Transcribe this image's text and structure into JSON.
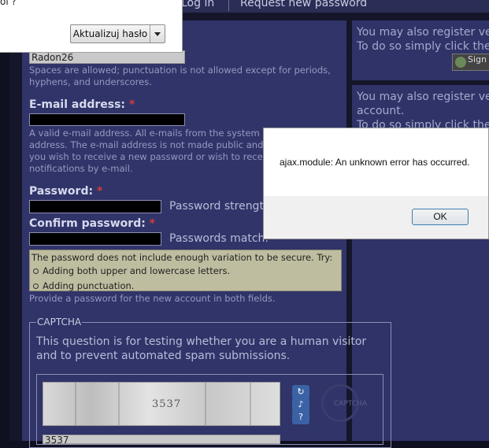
{
  "nav": {
    "tab_login": "Log in",
    "tab_request_password": "Request new password"
  },
  "sidebar": {
    "box1_line1": "You may also register very",
    "box1_line2": "To do so simply click there:",
    "sign_button": "Sign",
    "box2_line1": "You may also register very",
    "box2_line2": "account.",
    "box2_line3": "To do so simply click there:"
  },
  "form": {
    "username_value": "Radon26",
    "username_desc_1": "Spaces are allowed; punctuation is not allowed except for periods,",
    "username_desc_2": "hyphens, and underscores.",
    "email_label": "E-mail address:",
    "required_mark": "*",
    "email_desc_1": "A valid e-mail address. All e-mails from the system will be sent to this",
    "email_desc_2": "address. The e-mail address is not made public and will only be used if",
    "email_desc_3": "you wish to receive a new password or wish to receive certain news or",
    "email_desc_4": "notifications by e-mail.",
    "password_label": "Password:",
    "password_strength_label": "Password strength:",
    "confirm_label": "Confirm password:",
    "passwords_match_label": "Passwords match:",
    "pw_warning_title": "The password does not include enough variation to be secure. Try:",
    "pw_tips": [
      "Adding both upper and lowercase letters.",
      "Adding punctuation."
    ],
    "pw_provide": "Provide a password for the new account in both fields."
  },
  "captcha": {
    "legend": "CAPTCHA",
    "description": "This question is for testing whether you are a human visitor and to prevent automated spam submissions.",
    "image_text": "3537",
    "answer_value": "3537",
    "refresh_icon": "refresh-icon",
    "audio_icon": "audio-icon",
    "help_icon": "help-icon",
    "logo_text": "CAPTCHA"
  },
  "browser_popup": {
    "question_fragment": "ol ?",
    "update_button": "Aktualizuj hasło"
  },
  "alert": {
    "message": "ajax.module: An unknown error has occurred.",
    "ok_button": "OK"
  },
  "colors": {
    "page_bg": "#0f1020",
    "panel_bg": "#2f3368",
    "required": "#d43c3c",
    "warning_bg": "#bfbda0"
  }
}
